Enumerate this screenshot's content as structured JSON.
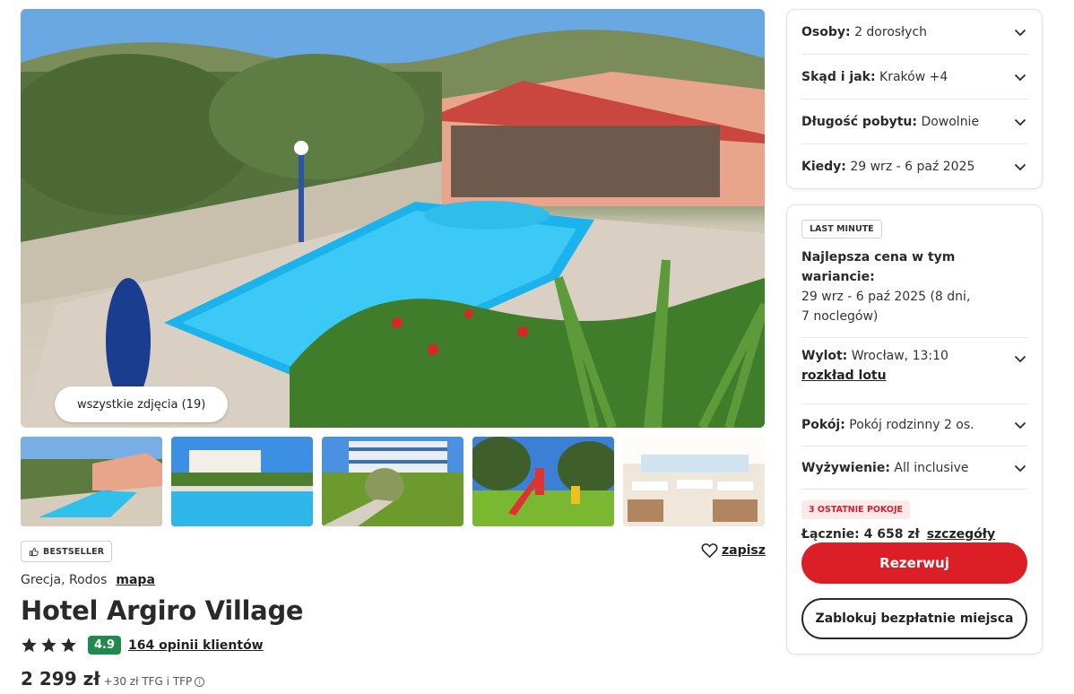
{
  "gallery": {
    "all_photos_label": "wszystkie zdjęcia (19)",
    "thumbnails": [
      {
        "icon": "pool-thumbnail"
      },
      {
        "icon": "pool-thumbnail"
      },
      {
        "icon": "hotel-garden-thumbnail"
      },
      {
        "icon": "playground-thumbnail"
      },
      {
        "icon": "restaurant-thumbnail"
      }
    ]
  },
  "hotel": {
    "badge": "BESTSELLER",
    "save_label": "zapisz",
    "location": "Grecja, Rodos",
    "map_label": "mapa",
    "name": "Hotel Argiro Village",
    "stars": 3,
    "score": "4.9",
    "reviews_label": "164 opinii klientów",
    "price": "2 299 zł",
    "price_extra": "+30 zł TFG i TFP"
  },
  "filters": {
    "persons_label": "Osoby:",
    "persons_value": "2 dorosłych",
    "from_label": "Skąd i jak:",
    "from_value": "Kraków +4",
    "duration_label": "Długość pobytu:",
    "duration_value": "Dowolnie",
    "when_label": "Kiedy:",
    "when_value": "29 wrz - 6 paź 2025"
  },
  "offer": {
    "badge": "LAST MINUTE",
    "best_price_label": "Najlepsza cena w tym wariancie:",
    "best_price_dates_line1": "29 wrz - 6 paź 2025 (8 dni,",
    "best_price_dates_line2": "7 noclegów)",
    "flight_label": "Wylot:",
    "flight_value": "Wrocław, 13:10",
    "flight_link": "rozkład lotu",
    "room_label": "Pokój:",
    "room_value": "Pokój rodzinny 2 os.",
    "board_label": "Wyżywienie:",
    "board_value": "All inclusive",
    "warning_badge": "3 OSTATNIE POKOJE",
    "total_label": "Łącznie: 4 658 zł",
    "details_link": "szczegóły",
    "reserve_button": "Rezerwuj",
    "block_button": "Zablokuj bezpłatnie miejsca"
  },
  "colors": {
    "accent_red": "#dc1f26",
    "score_green": "#1f8a4c",
    "warning_bg": "#fde8ea"
  }
}
